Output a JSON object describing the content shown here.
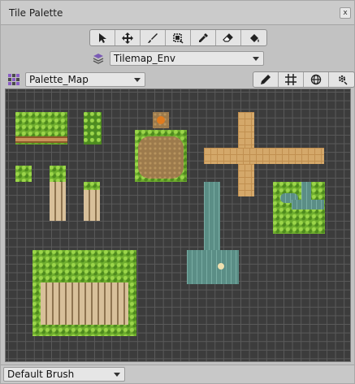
{
  "window": {
    "title": "Tile Palette",
    "close_glyph": "x"
  },
  "tools": [
    {
      "name": "select-tool",
      "icon": "arrow-cursor-icon"
    },
    {
      "name": "move-tool",
      "icon": "move-arrows-icon"
    },
    {
      "name": "paint-tool",
      "icon": "brush-icon"
    },
    {
      "name": "box-fill-tool",
      "icon": "box-fill-icon"
    },
    {
      "name": "picker-tool",
      "icon": "eyedropper-icon"
    },
    {
      "name": "erase-tool",
      "icon": "eraser-icon"
    },
    {
      "name": "fill-tool",
      "icon": "paint-bucket-icon"
    }
  ],
  "active_tilemap": {
    "label": "Tilemap_Env"
  },
  "palette": {
    "label": "Palette_Map"
  },
  "modes": [
    {
      "name": "edit-palette-toggle",
      "icon": "pencil-icon"
    },
    {
      "name": "grid-toggle",
      "icon": "grid-icon"
    },
    {
      "name": "gizmo-toggle",
      "icon": "globe-icon"
    },
    {
      "name": "settings-toggle",
      "icon": "gear-icon"
    }
  ],
  "brush": {
    "label": "Default Brush"
  }
}
